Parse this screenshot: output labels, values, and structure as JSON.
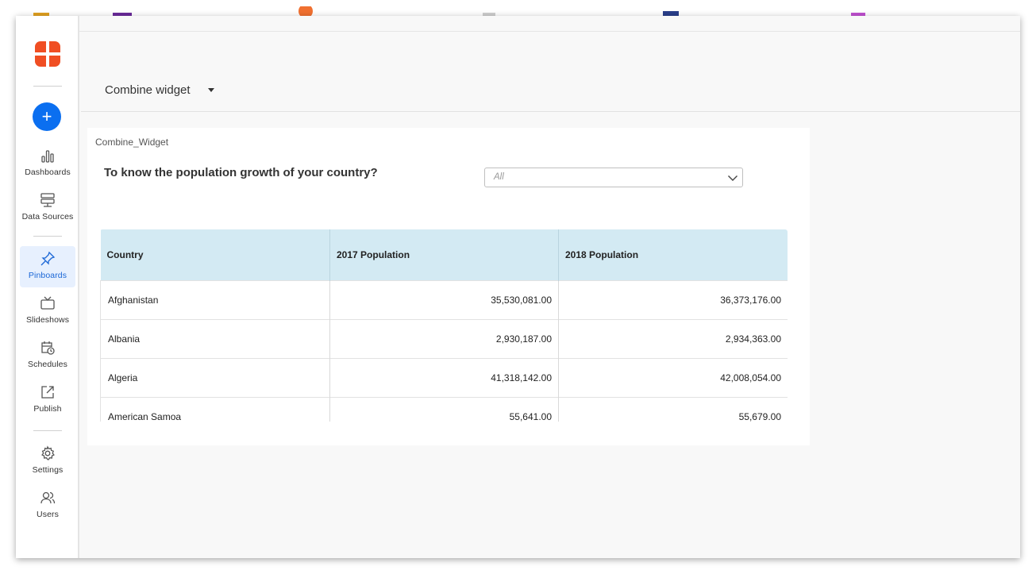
{
  "sidebar": {
    "create_label": "+",
    "nav": [
      {
        "label": "Dashboards",
        "icon": "bar-chart-icon",
        "active": false
      },
      {
        "label": "Data Sources",
        "icon": "server-icon",
        "active": false
      },
      {
        "label": "Pinboards",
        "icon": "pin-icon",
        "active": true
      },
      {
        "label": "Slideshows",
        "icon": "tv-icon",
        "active": false
      },
      {
        "label": "Schedules",
        "icon": "calendar-clock-icon",
        "active": false
      },
      {
        "label": "Publish",
        "icon": "share-icon",
        "active": false
      },
      {
        "label": "Settings",
        "icon": "gear-icon",
        "active": false
      },
      {
        "label": "Users",
        "icon": "users-icon",
        "active": false
      }
    ]
  },
  "header": {
    "title": "Combine widget"
  },
  "widget": {
    "name": "Combine_Widget",
    "question": "To know the population growth of your country?",
    "filter": {
      "value": "All"
    },
    "table": {
      "columns": [
        "Country",
        "2017 Population",
        "2018 Population"
      ],
      "rows": [
        [
          "Afghanistan",
          "35,530,081.00",
          "36,373,176.00"
        ],
        [
          "Albania",
          "2,930,187.00",
          "2,934,363.00"
        ],
        [
          "Algeria",
          "41,318,142.00",
          "42,008,054.00"
        ],
        [
          "American Samoa",
          "55,641.00",
          "55,679.00"
        ]
      ]
    }
  },
  "colors": {
    "accent": "#0b6ff0",
    "logo": "#f04e23",
    "table_header": "#d3eaf3",
    "active_nav": "#e7f0fe"
  }
}
